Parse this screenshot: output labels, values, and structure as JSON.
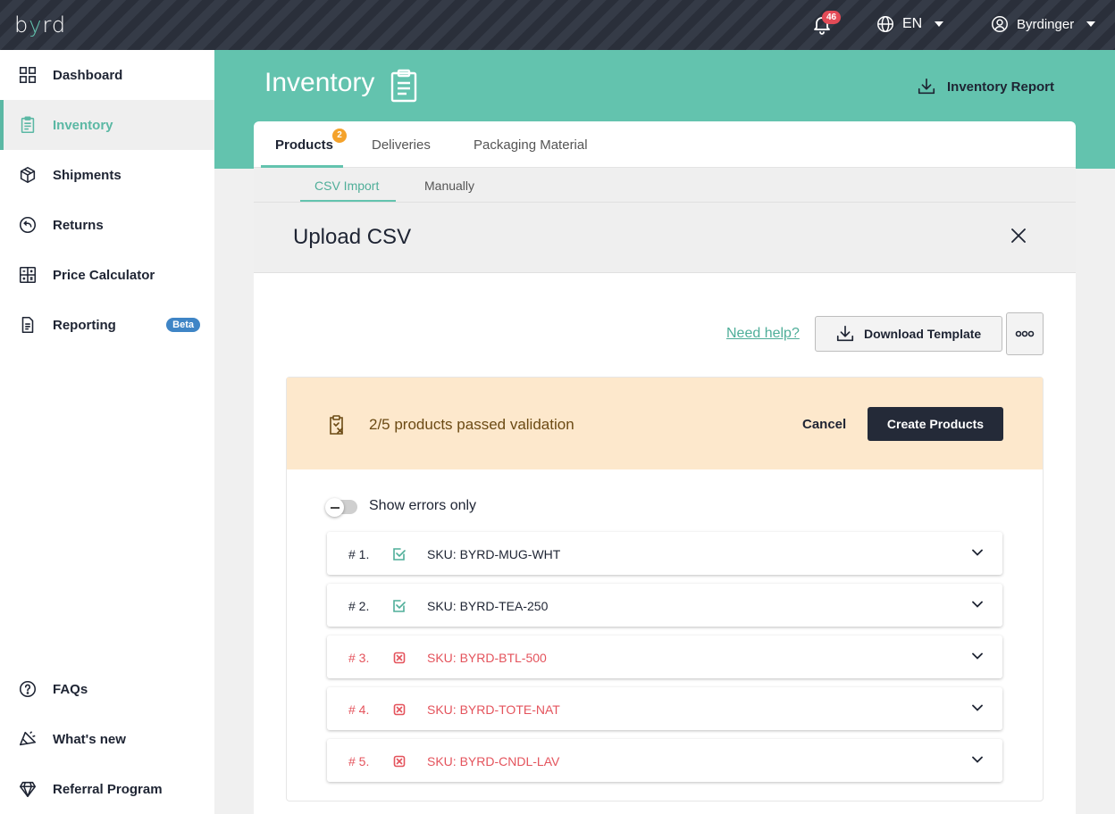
{
  "topbar": {
    "logo_text_1": "b",
    "logo_text_accent": "y",
    "logo_text_2": "rd",
    "notifications_count": "46",
    "language": "EN",
    "user_name": "Byrdinger"
  },
  "sidebar": {
    "items": [
      {
        "label": "Dashboard",
        "icon": "grid-icon"
      },
      {
        "label": "Inventory",
        "icon": "clipboard-icon"
      },
      {
        "label": "Shipments",
        "icon": "box-icon"
      },
      {
        "label": "Returns",
        "icon": "return-icon"
      },
      {
        "label": "Price Calculator",
        "icon": "calculator-icon"
      },
      {
        "label": "Reporting",
        "icon": "document-icon",
        "badge": "Beta"
      }
    ],
    "bottom_items": [
      {
        "label": "FAQs",
        "icon": "question-icon"
      },
      {
        "label": "What's new",
        "icon": "megaphone-icon"
      },
      {
        "label": "Referral Program",
        "icon": "diamond-icon"
      }
    ],
    "active_index": 1
  },
  "header": {
    "title": "Inventory",
    "report_label": "Inventory Report"
  },
  "tabs": [
    {
      "label": "Products",
      "badge": "2",
      "active": true
    },
    {
      "label": "Deliveries"
    },
    {
      "label": "Packaging Material"
    }
  ],
  "subtabs": [
    {
      "label": "CSV Import",
      "active": true
    },
    {
      "label": "Manually"
    }
  ],
  "upload": {
    "title": "Upload CSV",
    "help_link": "Need help?",
    "download_label": "Download Template",
    "banner_text": "2/5 products passed validation",
    "cancel_label": "Cancel",
    "create_label": "Create Products",
    "toggle_label": "Show errors only",
    "toggle_on": false
  },
  "rows": [
    {
      "num": "# 1.",
      "sku": "SKU: BYRD-MUG-WHT",
      "status": "passed"
    },
    {
      "num": "# 2.",
      "sku": "SKU: BYRD-TEA-250",
      "status": "passed"
    },
    {
      "num": "# 3.",
      "sku": "SKU: BYRD-BTL-500",
      "status": "error"
    },
    {
      "num": "# 4.",
      "sku": "SKU: BYRD-TOTE-NAT",
      "status": "error"
    },
    {
      "num": "# 5.",
      "sku": "SKU: BYRD-CNDL-LAV",
      "status": "error"
    }
  ],
  "colors": {
    "brand_teal": "#63c3ae",
    "dark": "#242a38",
    "error_red": "#e4535c",
    "warning_bg": "#fde8cc",
    "badge_red": "#e34b57",
    "badge_orange": "#f4a22b",
    "beta_blue": "#3f85c6"
  }
}
